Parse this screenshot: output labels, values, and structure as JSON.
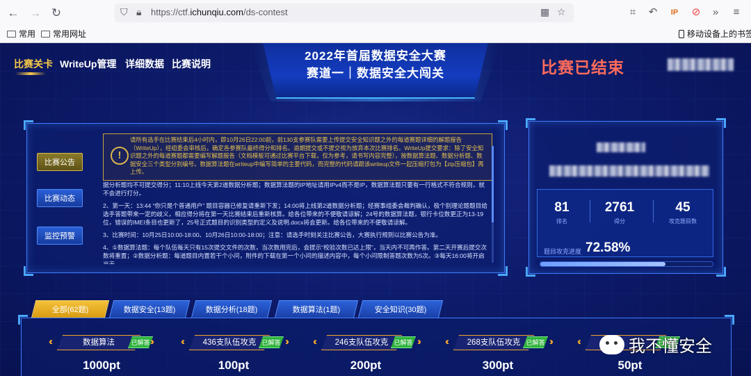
{
  "browser": {
    "url_prefix": "https://ctf.",
    "url_domain": "ichunqiu.com",
    "url_path": "/ds-contest",
    "bookmarks": [
      "常用",
      "常用网址"
    ],
    "mobile_bookmarks": "移动设备上的书签"
  },
  "nav": {
    "items": [
      "比赛关卡",
      "WriteUp管理",
      "详细数据",
      "比赛说明"
    ]
  },
  "header": {
    "title_line1": "2022年首届数据安全大赛",
    "title_line2": "赛道一｜数据安全大闯关",
    "status": "比赛已结束"
  },
  "sidebar": {
    "buttons": [
      "比赛公告",
      "比赛动态",
      "监控预警"
    ]
  },
  "notice": {
    "icon": "!",
    "text": "请所有选手在比赛结束后4小时内，即10月26日22:00前，前130支参赛队需要上传提交安全知识题之外的每道赛题详细的解题报告（WriteUp），经组委会审核后，确定各参赛队最终得分和排名。逾期提交或不提交视为放弃本次比赛排名。WriteUp提交要求：除了安全知识题之外的每道赛题都需要编写解题报告（文档模板可通过比赛平台下载，仅为参考，请书写内容完整），按数据算法题、数据分析题、数据安全三个类型分别编号。数据算法题在writeup中编写简单的主要代码，而完整的代码请跟该writeup文件一起压缩打包为【zip压缩包】再上传。"
  },
  "content": {
    "p0": "据分析题均不可提交得分；11:10上线今天第2道数据分析题；数据算法题的IP地址请用IPv4而不是IP，数据算法题只要有一行格式不符合规则，就不会进行打分。",
    "p1": "2、第一天：13:44 “你只是个普通用户” 题目容器已修复请重新下发；14:00将上线第2道数据分析题；经赛事组委会裁判确认，极个别理论题题目给选手答题带来一定的歧义，相应得分将在第一天比赛结束后重新核算。给各位带来的不便敬请谅解；24号的数据算法题，银行卡位数更正为13-19位，错误的IMEI条目也更新了，25号正式题目的识别类型的定义及说明.docx将会更新。给各位带来的不便敬请谅解。",
    "p2": "3、比赛时间：10月25日10:00-18:00、10月26日10:00-18:00；注意：请选手时刻关注比赛公告，大赛执行规则以比赛公告为准。",
    "p3": "4、①数据算法题：每个队伍每天只有15次提交文件的次数，当次数用完后，会提示“校验次数已达上限”，当天内不可再作答。第二天开赛后提交次数将重置；②数据分析题：每道题目内置若干个小问，附件的下载在第一个小问的描述内容中，每个小问限制答题次数为5次。③每天16:00将开启当天"
  },
  "stats": {
    "rank": "81",
    "rank_label": "排名",
    "score": "2761",
    "score_label": "得分",
    "solved": "45",
    "solved_label": "攻克题目数",
    "progress_label": "题目攻克进度",
    "progress_value": "72.58%",
    "progress_fraction": 0.7258
  },
  "tabs": [
    "全部(62题)",
    "数据安全(13题)",
    "数据分析(18题)",
    "数据算法(1题)",
    "安全知识(30题)"
  ],
  "cards": [
    {
      "name": "数据算法",
      "badge": "已解答",
      "points": "1000pt"
    },
    {
      "name": "436支队伍攻克",
      "badge": "已解答",
      "points": "100pt"
    },
    {
      "name": "246支队伍攻克",
      "badge": "已解答",
      "points": "200pt"
    },
    {
      "name": "268支队伍攻克",
      "badge": "已解答",
      "points": "300pt"
    },
    {
      "name": "",
      "badge": "已解答",
      "points": "50pt"
    }
  ],
  "watermark": "我不懂安全",
  "colors": {
    "accent_gold": "#f7c948",
    "ended_red": "#ff6b5b",
    "solved_green": "#2fb33c",
    "panel_blue": "#3f7dff"
  }
}
